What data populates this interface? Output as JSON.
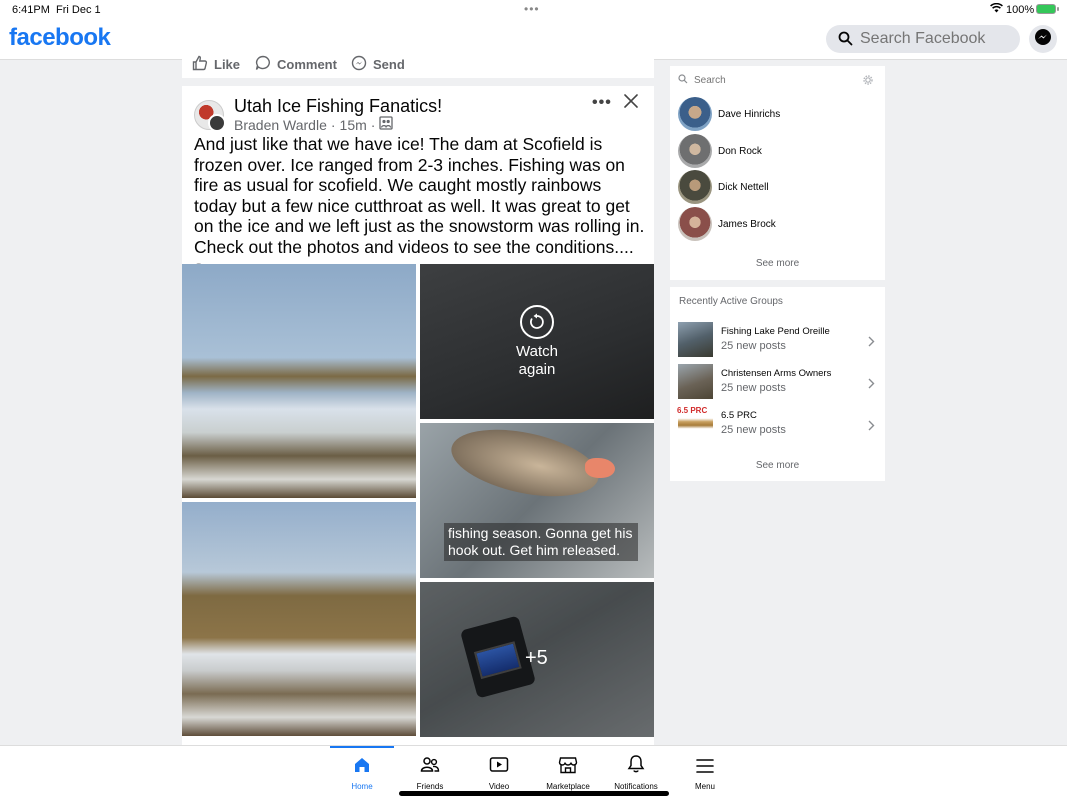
{
  "status_bar": {
    "time": "6:41PM",
    "date": "Fri Dec 1",
    "dots": "•••",
    "battery_percent": "100%"
  },
  "header": {
    "logo": "facebook",
    "search_placeholder": "Search Facebook",
    "brand_color": "#1877f2"
  },
  "previous_post_actions": {
    "like": "Like",
    "comment": "Comment",
    "send": "Send"
  },
  "post": {
    "group_name": "Utah Ice Fishing Fanatics!",
    "author": "Braden Wardle",
    "time": "15m",
    "separator": "·",
    "more": "•••",
    "text": "And just like that we have ice! The dam at Scofield is frozen over. Ice ranged from 2-3 inches. Fishing was on fire as usual for scofield. We caught mostly rainbows today but a few nice cutthroat as well. It was great to get on the ice and we left just as the snowstorm was rolling in. Check out the photos and videos to see the conditions....",
    "see_more": "See more",
    "watch_again": "Watch again",
    "caption": "fishing season. Gonna get his hook out. Get him released.",
    "extra_count": "+5"
  },
  "contacts": {
    "search_placeholder": "Search",
    "items": [
      {
        "name": "Dave Hinrichs"
      },
      {
        "name": "Don Rock"
      },
      {
        "name": "Dick Nettell"
      },
      {
        "name": "James Brock"
      }
    ],
    "see_more": "See more"
  },
  "groups": {
    "title": "Recently Active Groups",
    "items": [
      {
        "name": "Fishing Lake Pend Oreille",
        "sub": "25 new posts"
      },
      {
        "name": "Christensen Arms Owners",
        "sub": "25 new posts"
      },
      {
        "name": "6.5 PRC",
        "sub": "25 new posts",
        "thumb_text": "6.5 PRC"
      }
    ],
    "see_more": "See more"
  },
  "tabs": [
    {
      "label": "Home",
      "icon": "home-icon",
      "active": true
    },
    {
      "label": "Friends",
      "icon": "friends-icon"
    },
    {
      "label": "Video",
      "icon": "video-icon"
    },
    {
      "label": "Marketplace",
      "icon": "marketplace-icon"
    },
    {
      "label": "Notifications",
      "icon": "bell-icon"
    },
    {
      "label": "Menu",
      "icon": "hamburger-icon"
    }
  ]
}
